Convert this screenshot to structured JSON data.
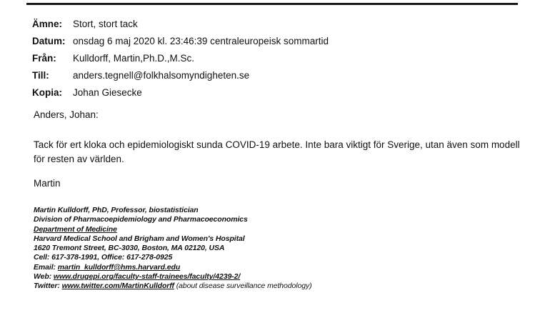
{
  "email": {
    "header": {
      "subject_label": "Ämne:",
      "subject": "Stort, stort tack",
      "date_label": "Datum:",
      "date": "onsdag 6 maj 2020 kl. 23:46:39 centraleuropeisk sommartid",
      "from_label": "Från:",
      "from": "Kulldorff, Martin,Ph.D.,M.Sc.",
      "to_label": "Till:",
      "to": "anders.tegnell@folkhalsomyndigheten.se",
      "cc_label": "Kopia:",
      "cc": "Johan Giesecke"
    },
    "greeting": "Anders, Johan:",
    "body": "Tack för ert kloka och epidemiologiskt sunda COVID-19 arbete. Inte bara viktigt för Sverige, utan även som modell för resten av världen.",
    "signoff": "Martin",
    "signature": {
      "line1": "Martin Kulldorff, PhD, Professor, biostatistician",
      "line2": "Division of Pharmacoepidemiology and Pharmacoeconomics",
      "line3": "Department of Medicine",
      "line4": "Harvard Medical School and Brigham and Women's Hospital",
      "line5": "1620 Tremont Street, BC-3030, Boston, MA 02120, USA",
      "line6": "Cell: 617-378-1991, Office: 617-278-0925",
      "email_label": "Email:",
      "email": "martin_kulldorff@hms.harvard.edu",
      "web_label": "Web:",
      "web": "www.drugepi.org/faculty-staff-trainees/faculty/4239-2/",
      "twitter_label": "Twitter:",
      "twitter": "www.twitter.com/MartinKulldorff",
      "twitter_note": "(about disease surveillance methodology)"
    }
  }
}
